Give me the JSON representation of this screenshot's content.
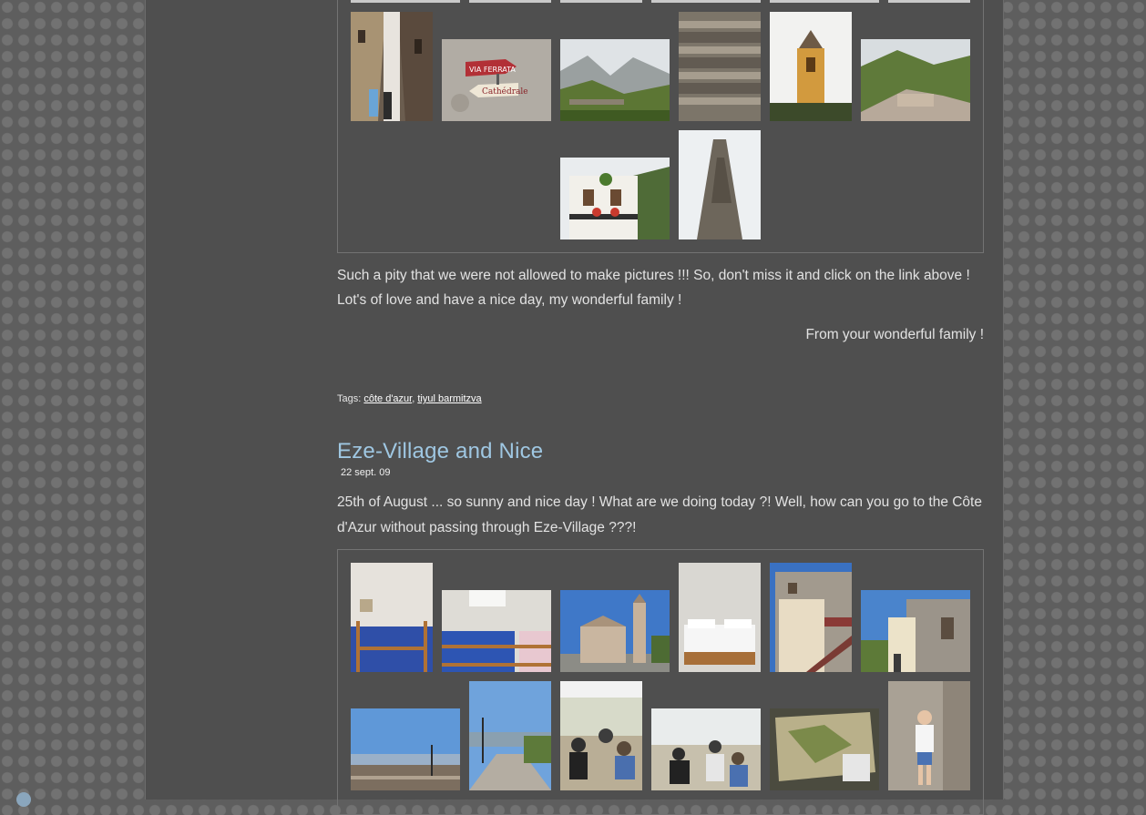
{
  "post1": {
    "closing_line1": "Such a pity that we were not allowed to make pictures !!! So, don't miss it and click on the link above !",
    "closing_line2": "Lot's of love and have a nice day, my wonderful family !",
    "signature": "From your wonderful family !",
    "tags_label": "Tags:",
    "tags": [
      "côte d'azur",
      "tiyul barmitzva"
    ],
    "tags_separator": ","
  },
  "post2": {
    "title": "Eze-Village and Nice",
    "date": "22 sept. 09",
    "intro_line1": "25th of August ... so sunny and nice day ! What are we doing today ?! Well, how can you go to the Côte",
    "intro_line2": "d'Azur without passing through Eze-Village ???!"
  },
  "colors": {
    "page_background": "#4f4f4f",
    "outer_pattern": "#5e5e5e",
    "title_blue": "#9fc7e2",
    "text": "#e2e2e2"
  }
}
